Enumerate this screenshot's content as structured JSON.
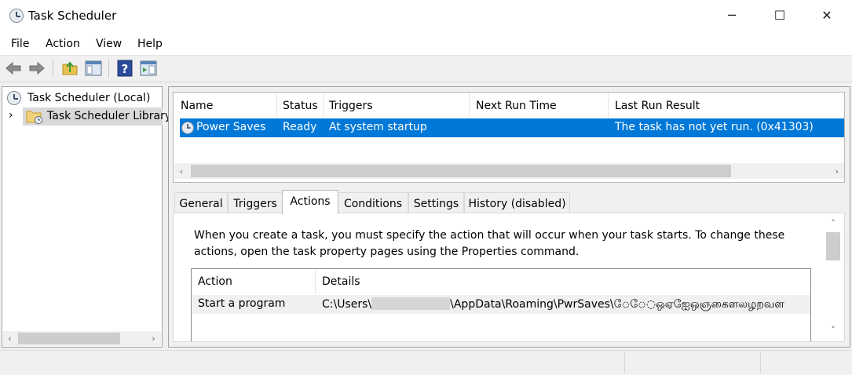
{
  "window": {
    "title": "Task Scheduler",
    "controls": {
      "minimize": "─",
      "maximize": "☐",
      "close": "✕"
    }
  },
  "menu": [
    "File",
    "Action",
    "View",
    "Help"
  ],
  "toolbar": [
    "back-arrow-icon",
    "forward-arrow-icon",
    "folder-up-icon",
    "show-hide-console-tree-icon",
    "help-icon",
    "show-hide-action-pane-icon"
  ],
  "tree": {
    "root": "Task Scheduler (Local)",
    "child": "Task Scheduler Library",
    "child_expander": "›"
  },
  "task_list": {
    "columns": [
      "Name",
      "Status",
      "Triggers",
      "Next Run Time",
      "Last Run Result"
    ],
    "rows": [
      {
        "name": "Power Saves",
        "status": "Ready",
        "triggers": "At system startup",
        "next_run": "",
        "last_result": "The task has not yet run. (0x41303)",
        "selected": true
      }
    ]
  },
  "tabs": [
    "General",
    "Triggers",
    "Actions",
    "Conditions",
    "Settings",
    "History (disabled)"
  ],
  "active_tab": "Actions",
  "actions_panel": {
    "description_line1": "When you create a task, you must specify the action that will occur when your task starts.  To change these",
    "description_line2": "actions, open the task property pages using the Properties command.",
    "columns": [
      "Action",
      "Details"
    ],
    "rows": [
      {
        "action": "Start a program",
        "details_prefix": "C:\\Users\\",
        "details_suffix": "\\AppData\\Roaming\\PwrSaves\\ே◌ே◌ஒஏஐேஒஞகைளலழறவள"
      }
    ]
  },
  "scroll": {
    "left": "‹",
    "right": "›",
    "up": "˄",
    "down": "˅"
  },
  "colors": {
    "selection": "#0078d7",
    "window_bg": "#f0f0f0",
    "pane_bg": "#ffffff"
  }
}
